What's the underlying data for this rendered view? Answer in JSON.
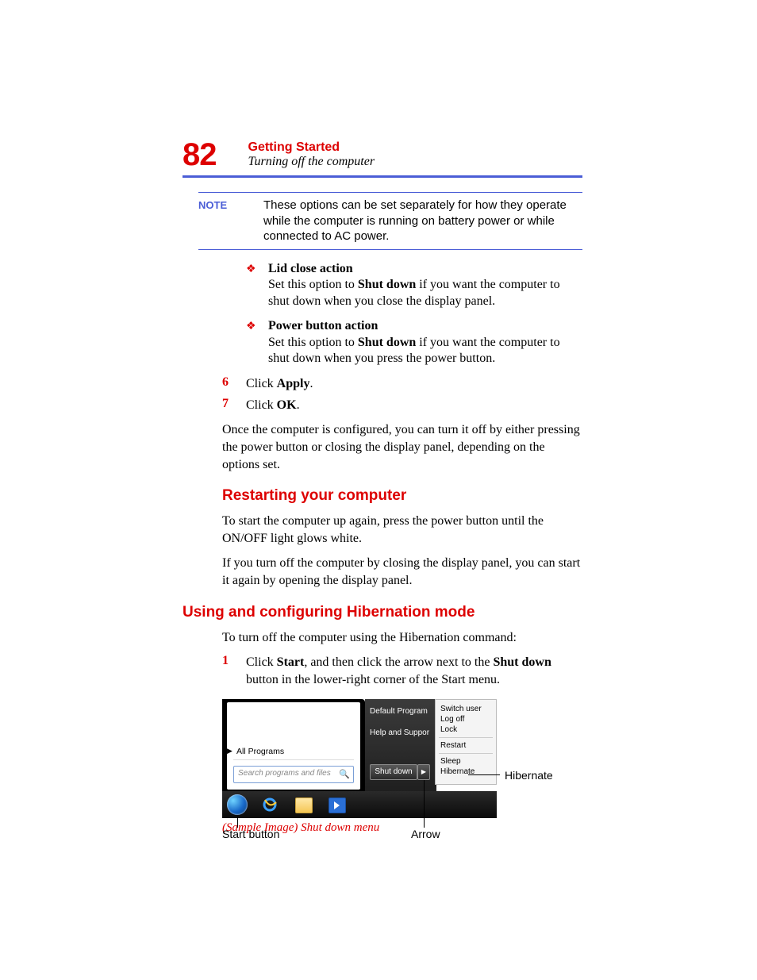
{
  "header": {
    "page_number": "82",
    "chapter": "Getting Started",
    "section": "Turning off the computer"
  },
  "note": {
    "label": "NOTE",
    "text": "These options can be set separately for how they operate while the computer is running on battery power or while connected to AC power."
  },
  "bullets": [
    {
      "title": "Lid close action",
      "text_a": "Set this option to ",
      "text_bold": "Shut down",
      "text_b": " if you want the computer to shut down when you close the display panel."
    },
    {
      "title": "Power button action",
      "text_a": "Set this option to ",
      "text_bold": "Shut down",
      "text_b": " if you want the computer to shut down when you press the power button."
    }
  ],
  "steps_a": [
    {
      "num": "6",
      "pre": "Click ",
      "bold": "Apply",
      "post": "."
    },
    {
      "num": "7",
      "pre": "Click ",
      "bold": "OK",
      "post": "."
    }
  ],
  "para_after_steps": "Once the computer is configured, you can turn it off by either pressing the power button or closing the display panel, depending on the options set.",
  "restart": {
    "heading": "Restarting your computer",
    "p1": "To start the computer up again, press the power button until the ON/OFF light glows white.",
    "p2": "If you turn off the computer by closing the display panel, you can start it again by opening the display panel."
  },
  "hiber": {
    "heading": "Using and configuring Hibernation mode",
    "p1": "To turn off the computer using the Hibernation command:",
    "step": {
      "num": "1",
      "a": "Click ",
      "b1": "Start",
      "c": ", and then click the arrow next to the ",
      "b2": "Shut down",
      "d": " button in the lower-right corner of the Start menu."
    }
  },
  "sample": {
    "all_programs": "All Programs",
    "search_placeholder": "Search programs and files",
    "right_items": [
      "Default Program",
      "Help and Suppor"
    ],
    "shutdown": "Shut down",
    "context_items": [
      "Switch user",
      "Log off",
      "Lock",
      "Restart",
      "Sleep",
      "Hibernate"
    ],
    "callout_start": "Start button",
    "callout_arrow": "Arrow",
    "callout_hibernate": "Hibernate",
    "caption": "(Sample Image) Shut down menu"
  }
}
